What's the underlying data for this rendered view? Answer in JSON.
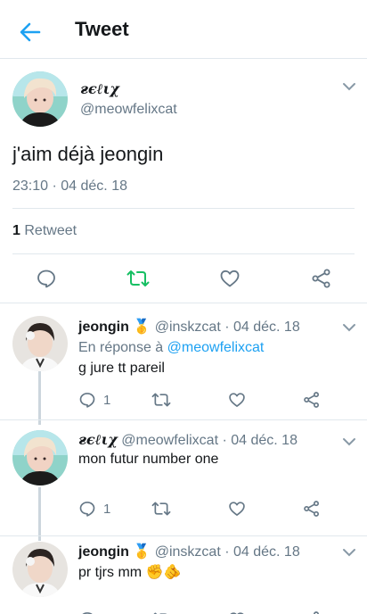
{
  "header": {
    "title": "Tweet"
  },
  "main_tweet": {
    "name": "ғєℓιχ",
    "handle": "@meowfelixcat",
    "text": "j'aim déjà jeongin",
    "timestamp": "23:10 · 04 déc. 18",
    "retweet_count": "1",
    "retweet_label": "Retweet"
  },
  "replies": [
    {
      "name": "jeongin",
      "badge": "🥇",
      "handle": "@inskzcat",
      "date": "04 déc. 18",
      "reply_prefix": "En réponse à",
      "reply_to": "@meowfelixcat",
      "text": "g jure tt pareil",
      "reply_count": "1"
    },
    {
      "name": "ғєℓιχ",
      "handle": "@meowfelixcat",
      "date": "04 déc. 18",
      "text": "mon futur number one",
      "reply_count": "1"
    },
    {
      "name": "jeongin",
      "badge": "🥇",
      "handle": "@inskzcat",
      "date": "04 déc. 18",
      "text": "pr tjrs mm ✊🫵"
    }
  ],
  "colors": {
    "accent": "#1da1f2",
    "retweet_active": "#17bf63",
    "muted": "#657786",
    "border": "#e1e8ed"
  }
}
